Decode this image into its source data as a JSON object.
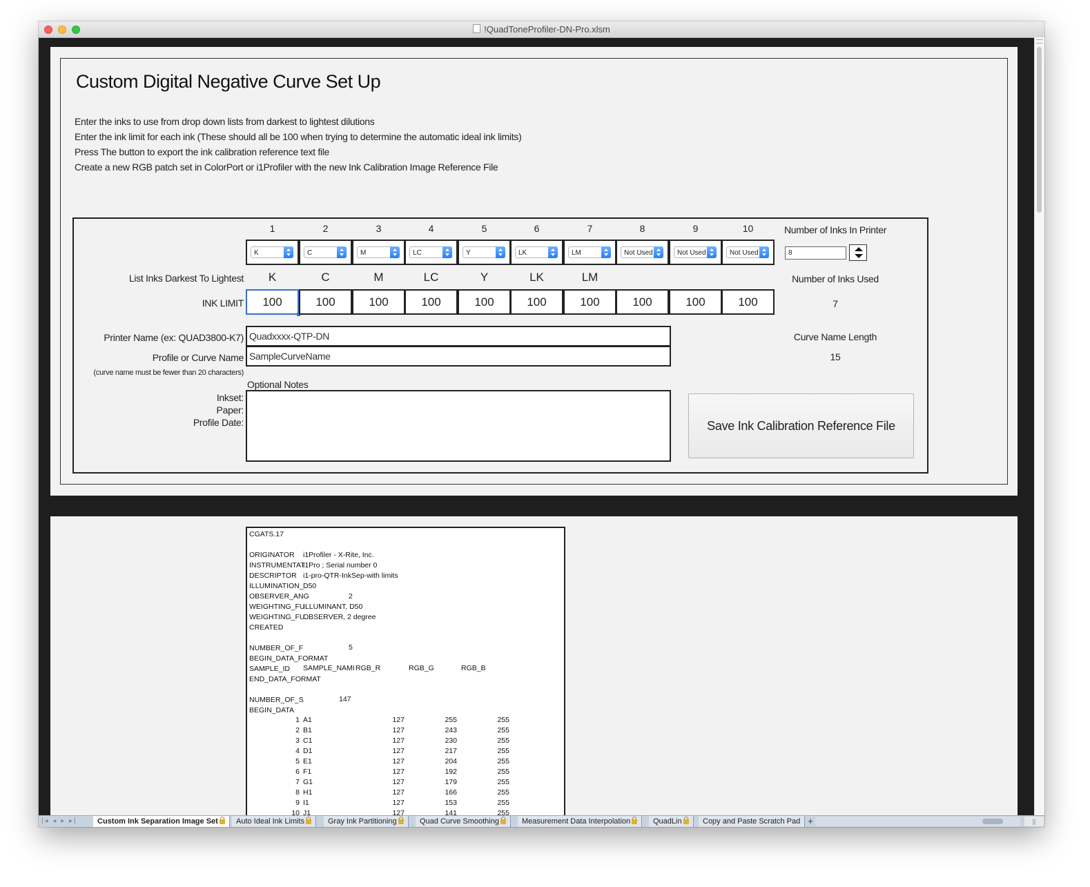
{
  "window": {
    "title": "!QuadToneProfiler-DN-Pro.xlsm"
  },
  "setup": {
    "title": "Custom Digital Negative Curve Set Up",
    "instructions": [
      "Enter the inks to use from drop down lists from darkest to lightest dilutions",
      "Enter the ink limit for each ink (These should all be 100 when trying to determine the automatic ideal ink limits)",
      "Press The button to export the ink calibration reference text file",
      "Create a new RGB patch set in ColorPort or i1Profiler with the new Ink Calibration Image Reference File"
    ],
    "columns": [
      "1",
      "2",
      "3",
      "4",
      "5",
      "6",
      "7",
      "8",
      "9",
      "10"
    ],
    "dropdowns": [
      "K",
      "C",
      "M",
      "LC",
      "Y",
      "LK",
      "LM",
      "Not Used",
      "Not Used",
      "Not Used"
    ],
    "ink_names": [
      "K",
      "C",
      "M",
      "LC",
      "Y",
      "LK",
      "LM",
      "",
      "",
      ""
    ],
    "ink_limits": [
      "100",
      "100",
      "100",
      "100",
      "100",
      "100",
      "100",
      "100",
      "100",
      "100"
    ],
    "list_label": "List Inks Darkest To Lightest",
    "ink_limit_label": "INK LIMIT",
    "printer_name_label": "Printer Name (ex: QUAD3800-K7)",
    "printer_name_value": "Quadxxxx-QTP-DN",
    "curve_name_label": "Profile or Curve Name",
    "curve_name_value": "SampleCurveName",
    "curve_note": "(curve name must be fewer than 20 characters)",
    "optional_notes_label": "Optional Notes",
    "notes_labels": [
      "Inkset:",
      "Paper:",
      "Profile Date:"
    ],
    "num_inks_printer_label": "Number of Inks In Printer",
    "num_inks_printer_value": "8",
    "num_inks_used_label": "Number of Inks Used",
    "num_inks_used_value": "7",
    "curve_name_length_label": "Curve Name Length",
    "curve_name_length_value": "15",
    "save_button": "Save Ink Calibration Reference File"
  },
  "cgats": {
    "header_lines": [
      "CGATS.17",
      "",
      "ORIGINATOR",
      "INSTRUMENTAT",
      "DESCRIPTOR",
      "ILLUMINATION_",
      "OBSERVER_ANG",
      "WEIGHTING_FU",
      "WEIGHTING_FU",
      "CREATED",
      "",
      "NUMBER_OF_F",
      "BEGIN_DATA_FORMAT",
      "SAMPLE_ID",
      "END_DATA_FORMAT",
      "",
      "NUMBER_OF_S",
      "BEGIN_DATA"
    ],
    "header_values": {
      "originator": "i1Profiler - X-Rite, Inc.",
      "instrumentation": "i1Pro ; Serial number 0",
      "descriptor": "i1-pro-QTR-InkSep-with limits",
      "illumination": "D50",
      "observer_angle": "2",
      "weighting_1": "ILLUMINANT, D50",
      "weighting_2": "OBSERVER, 2 degree",
      "number_of_fields": "5",
      "number_of_sets": "147"
    },
    "format_fields": [
      "SAMPLE_NAMI",
      "RGB_R",
      "RGB_G",
      "RGB_B"
    ],
    "rows": [
      [
        "1",
        "A1",
        "127",
        "255",
        "255"
      ],
      [
        "2",
        "B1",
        "127",
        "243",
        "255"
      ],
      [
        "3",
        "C1",
        "127",
        "230",
        "255"
      ],
      [
        "4",
        "D1",
        "127",
        "217",
        "255"
      ],
      [
        "5",
        "E1",
        "127",
        "204",
        "255"
      ],
      [
        "6",
        "F1",
        "127",
        "192",
        "255"
      ],
      [
        "7",
        "G1",
        "127",
        "179",
        "255"
      ],
      [
        "8",
        "H1",
        "127",
        "166",
        "255"
      ],
      [
        "9",
        "I1",
        "127",
        "153",
        "255"
      ],
      [
        "10",
        "J1",
        "127",
        "141",
        "255"
      ]
    ]
  },
  "tabs": [
    {
      "label": "Custom Ink Separation Image Set",
      "active": true
    },
    {
      "label": "Auto Ideal Ink Limits",
      "active": false
    },
    {
      "label": "Gray Ink Partitioning",
      "active": false
    },
    {
      "label": "Quad Curve Smoothing",
      "active": false
    },
    {
      "label": "Measurement Data Interpolation",
      "active": false
    },
    {
      "label": "QuadLin",
      "active": false
    },
    {
      "label": "Copy and Paste Scratch Pad",
      "active": false
    }
  ],
  "tab_nav": "|◂ ◂ ▸ ▸|",
  "tab_add": "+",
  "icons": {
    "close": "close-button",
    "minimize": "minimize-button",
    "zoom": "zoom-button",
    "lock": "lock-icon",
    "document": "document-icon"
  },
  "colors": {
    "close": "#fc605c",
    "minimize": "#fdbc40",
    "zoom": "#34c84a",
    "select_accent": "#2a7ff2",
    "sheet_bg": "#f2f2f2",
    "window_dark": "#1e1e1e"
  }
}
